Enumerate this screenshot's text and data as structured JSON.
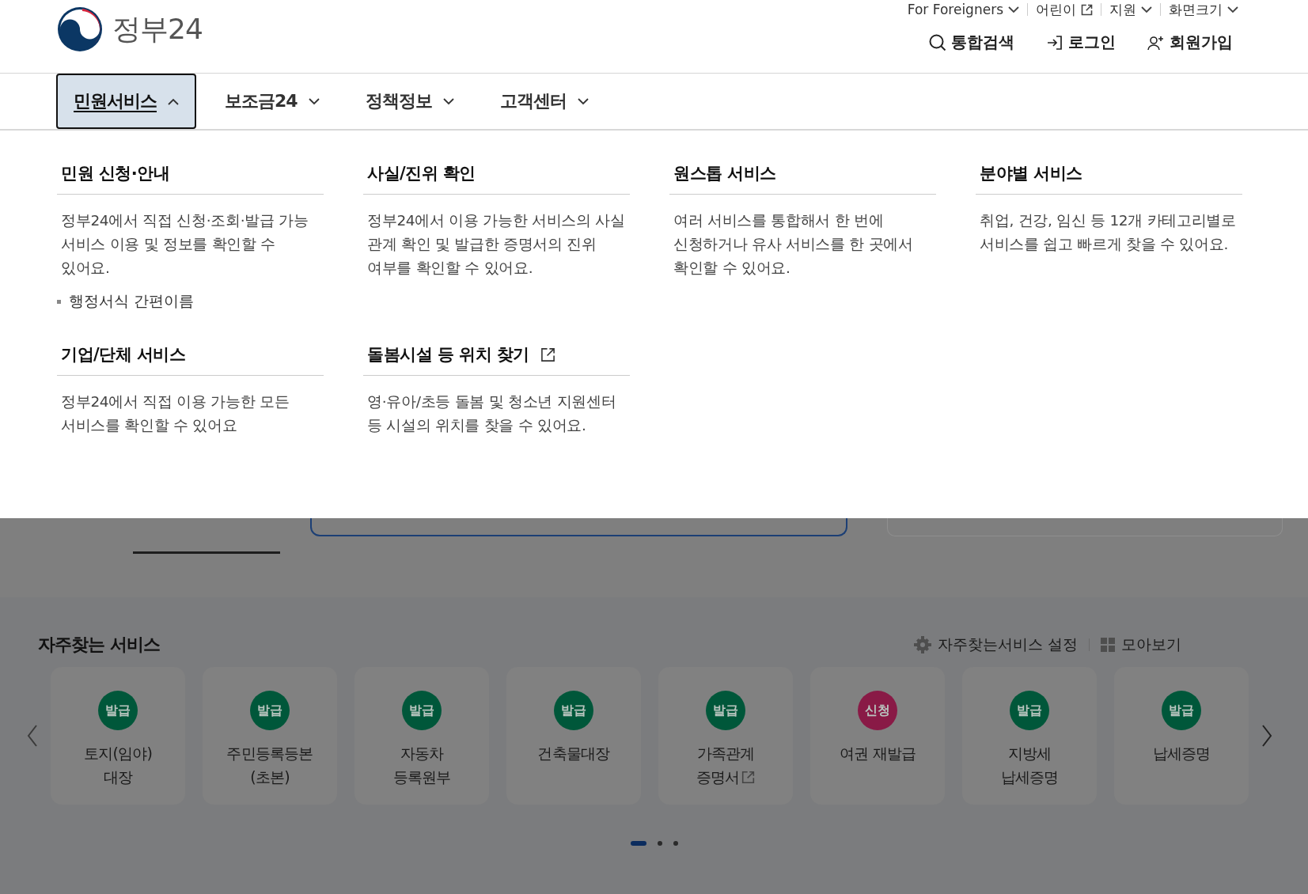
{
  "header": {
    "logo_text": "정부24",
    "utility_links": [
      {
        "label": "For Foreigners",
        "kind": "dropdown"
      },
      {
        "label": "어린이",
        "kind": "external"
      },
      {
        "label": "지원",
        "kind": "dropdown"
      },
      {
        "label": "화면크기",
        "kind": "dropdown"
      }
    ],
    "actions": [
      {
        "label": "통합검색",
        "kind": "search"
      },
      {
        "label": "로그인",
        "kind": "login"
      },
      {
        "label": "회원가입",
        "kind": "signup"
      }
    ]
  },
  "nav": [
    {
      "label": "민원서비스",
      "selected": true,
      "expanded": true
    },
    {
      "label": "보조금24",
      "selected": false,
      "expanded": false
    },
    {
      "label": "정책정보",
      "selected": false,
      "expanded": false
    },
    {
      "label": "고객센터",
      "selected": false,
      "expanded": false
    }
  ],
  "mega_menu": {
    "sections": [
      {
        "title": "민원 신청·안내",
        "external": false,
        "description": "정부24에서 직접 신청·조회·발급 가능 서비스 이용 및 정보를 확인할 수 있어요.",
        "links": [
          "행정서식 간편이름"
        ]
      },
      {
        "title": "사실/진위 확인",
        "external": false,
        "description": "정부24에서 이용 가능한 서비스의 사실 관계 확인 및 발급한 증명서의 진위 여부를 확인할 수 있어요."
      },
      {
        "title": "원스톱 서비스",
        "external": false,
        "description": "여러 서비스를 통합해서 한 번에 신청하거나 유사 서비스를 한 곳에서 확인할 수 있어요."
      },
      {
        "title": "분야별 서비스",
        "external": false,
        "description": "취업, 건강, 임신 등 12개 카테고리별로 서비스를 쉽고 빠르게 찾을 수 있어요."
      },
      {
        "title": "기업/단체 서비스",
        "external": false,
        "description": "정부24에서 직접 이용 가능한 모든 서비스를 확인할 수 있어요"
      },
      {
        "title": "돌봄시설 등 위치 찾기",
        "external": true,
        "description": "영·유아/초등 돌봄 및 청소년 지원센터 등 시설의 위치를 찾을 수 있어요."
      }
    ]
  },
  "favorites": {
    "title": "자주찾는 서비스",
    "settings": "자주찾는서비스 설정",
    "view_all": "모아보기",
    "cards": [
      {
        "badge": "발급",
        "color": "#00573a",
        "lines": [
          "토지(임야)",
          "대장"
        ],
        "external": false
      },
      {
        "badge": "발급",
        "color": "#00573a",
        "lines": [
          "주민등록등본",
          "(초본)"
        ],
        "external": false
      },
      {
        "badge": "발급",
        "color": "#00573a",
        "lines": [
          "자동차",
          "등록원부"
        ],
        "external": false
      },
      {
        "badge": "발급",
        "color": "#00573a",
        "lines": [
          "건축물대장"
        ],
        "external": false
      },
      {
        "badge": "발급",
        "color": "#00573a",
        "lines": [
          "가족관계",
          "증명서"
        ],
        "external": true
      },
      {
        "badge": "신청",
        "color": "#891a46",
        "lines": [
          "여권 재발급"
        ],
        "external": false
      },
      {
        "badge": "발급",
        "color": "#00573a",
        "lines": [
          "지방세",
          "납세증명"
        ],
        "external": false
      },
      {
        "badge": "발급",
        "color": "#00573a",
        "lines": [
          "납세증명"
        ],
        "external": false
      }
    ],
    "pages": [
      {
        "selected": true
      },
      {
        "selected": false
      },
      {
        "selected": false
      }
    ]
  }
}
